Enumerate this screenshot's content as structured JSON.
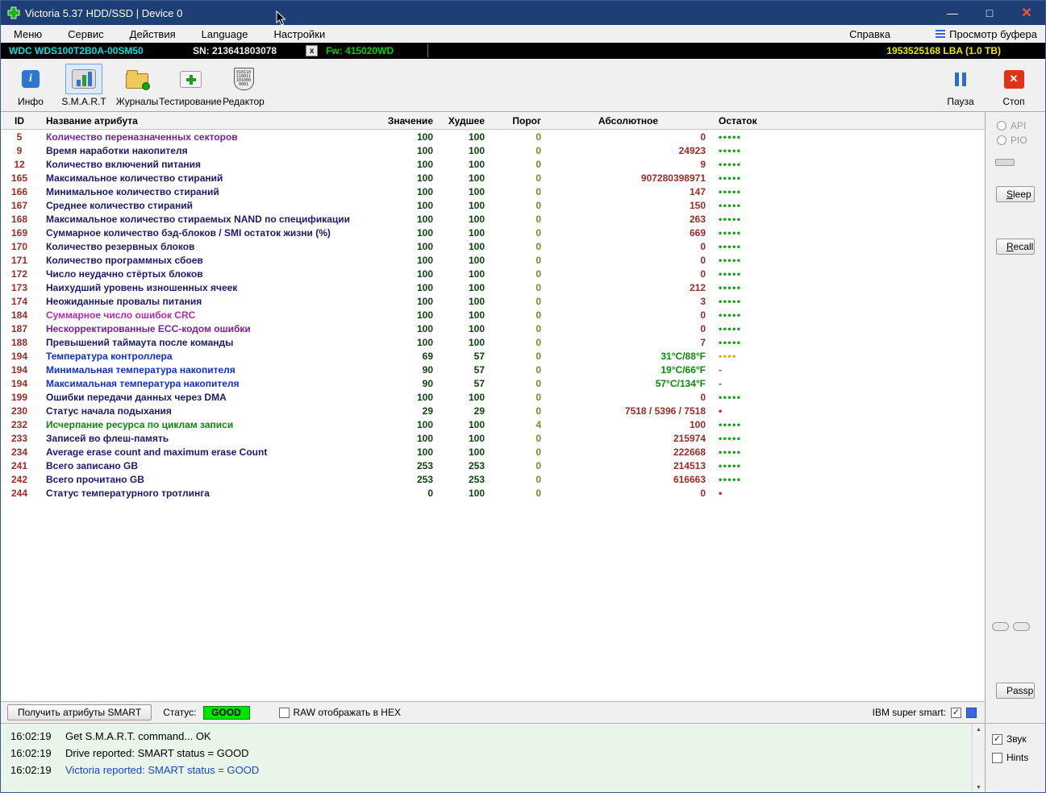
{
  "window": {
    "title": "Victoria 5.37 HDD/SSD | Device 0",
    "minimize": "—",
    "maximize": "□",
    "close": "✕"
  },
  "menu": {
    "items": [
      "Меню",
      "Сервис",
      "Действия",
      "Language",
      "Настройки"
    ],
    "help": "Справка",
    "buffer_view": "Просмотр буфера"
  },
  "device_bar": {
    "model": "WDC  WDS100T2B0A-00SM50",
    "serial": "SN: 213641803078",
    "x_badge": "x",
    "firmware": "Fw: 415020WD",
    "capacity": "1953525168 LBA (1.0 TB)"
  },
  "toolbar": {
    "info": "Инфо",
    "smart": "S.M.A.R.T",
    "journals": "Журналы",
    "testing": "Тестирование",
    "editor": "Редактор",
    "pause": "Пауза",
    "stop": "Стоп",
    "editor_binary": [
      "010110",
      "110011",
      "101000",
      "0001"
    ]
  },
  "table": {
    "headers": [
      "ID",
      "Название атрибута",
      "Значение",
      "Худшее",
      "Порог",
      "Абсолютное",
      "Остаток"
    ],
    "rows": [
      {
        "id": "5",
        "name": "Количество переназначенных секторов",
        "name_color": "purple",
        "value": "100",
        "worst": "100",
        "threshold": "0",
        "raw": "0",
        "raw_color": "maroon",
        "health": "•••••",
        "health_color": "green"
      },
      {
        "id": "9",
        "name": "Время наработки накопителя",
        "name_color": "navy",
        "value": "100",
        "worst": "100",
        "threshold": "0",
        "raw": "24923",
        "raw_color": "maroon",
        "health": "•••••",
        "health_color": "green"
      },
      {
        "id": "12",
        "name": "Количество включений питания",
        "name_color": "navy",
        "value": "100",
        "worst": "100",
        "threshold": "0",
        "raw": "9",
        "raw_color": "maroon",
        "health": "•••••",
        "health_color": "green"
      },
      {
        "id": "165",
        "name": "Максимальное количество стираний",
        "name_color": "navy",
        "value": "100",
        "worst": "100",
        "threshold": "0",
        "raw": "907280398971",
        "raw_color": "maroon",
        "health": "•••••",
        "health_color": "green"
      },
      {
        "id": "166",
        "name": "Минимальное количество стираний",
        "name_color": "navy",
        "value": "100",
        "worst": "100",
        "threshold": "0",
        "raw": "147",
        "raw_color": "maroon",
        "health": "•••••",
        "health_color": "green"
      },
      {
        "id": "167",
        "name": "Среднее количество стираний",
        "name_color": "navy",
        "value": "100",
        "worst": "100",
        "threshold": "0",
        "raw": "150",
        "raw_color": "maroon",
        "health": "•••••",
        "health_color": "green"
      },
      {
        "id": "168",
        "name": "Максимальное количество стираемых NAND по спецификации",
        "name_color": "navy",
        "value": "100",
        "worst": "100",
        "threshold": "0",
        "raw": "263",
        "raw_color": "maroon",
        "health": "•••••",
        "health_color": "green"
      },
      {
        "id": "169",
        "name": "Суммарное количество бэд-блоков / SMI остаток жизни (%)",
        "name_color": "navy",
        "value": "100",
        "worst": "100",
        "threshold": "0",
        "raw": "669",
        "raw_color": "maroon",
        "health": "•••••",
        "health_color": "green"
      },
      {
        "id": "170",
        "name": "Количество резервных блоков",
        "name_color": "navy",
        "value": "100",
        "worst": "100",
        "threshold": "0",
        "raw": "0",
        "raw_color": "maroon",
        "health": "•••••",
        "health_color": "green"
      },
      {
        "id": "171",
        "name": "Количество программных сбоев",
        "name_color": "navy",
        "value": "100",
        "worst": "100",
        "threshold": "0",
        "raw": "0",
        "raw_color": "maroon",
        "health": "•••••",
        "health_color": "green"
      },
      {
        "id": "172",
        "name": "Число неудачно стёртых блоков",
        "name_color": "navy",
        "value": "100",
        "worst": "100",
        "threshold": "0",
        "raw": "0",
        "raw_color": "maroon",
        "health": "•••••",
        "health_color": "green"
      },
      {
        "id": "173",
        "name": "Наихудший уровень изношенных ячеек",
        "name_color": "navy",
        "value": "100",
        "worst": "100",
        "threshold": "0",
        "raw": "212",
        "raw_color": "maroon",
        "health": "•••••",
        "health_color": "green"
      },
      {
        "id": "174",
        "name": "Неожиданные провалы питания",
        "name_color": "navy",
        "value": "100",
        "worst": "100",
        "threshold": "0",
        "raw": "3",
        "raw_color": "maroon",
        "health": "•••••",
        "health_color": "green"
      },
      {
        "id": "184",
        "name": "Суммарное число ошибок CRC",
        "name_color": "magenta",
        "value": "100",
        "worst": "100",
        "threshold": "0",
        "raw": "0",
        "raw_color": "maroon",
        "health": "•••••",
        "health_color": "green"
      },
      {
        "id": "187",
        "name": "Нескорректированные ECC-кодом ошибки",
        "name_color": "purple",
        "value": "100",
        "worst": "100",
        "threshold": "0",
        "raw": "0",
        "raw_color": "maroon",
        "health": "•••••",
        "health_color": "green"
      },
      {
        "id": "188",
        "name": "Превышений таймаута после команды",
        "name_color": "navy",
        "value": "100",
        "worst": "100",
        "threshold": "0",
        "raw": "7",
        "raw_color": "maroon",
        "health": "•••••",
        "health_color": "green"
      },
      {
        "id": "194",
        "name": "Температура контроллера",
        "name_color": "blue",
        "value": "69",
        "worst": "57",
        "threshold": "0",
        "raw": "31°C/88°F",
        "raw_color": "green",
        "health": "••••",
        "health_color": "orange"
      },
      {
        "id": "194",
        "name": "Минимальная температура накопителя",
        "name_color": "blue",
        "value": "90",
        "worst": "57",
        "threshold": "0",
        "raw": "19°C/66°F",
        "raw_color": "green",
        "health": "-",
        "health_color": "gray"
      },
      {
        "id": "194",
        "name": "Максимальная температура накопителя",
        "name_color": "blue",
        "value": "90",
        "worst": "57",
        "threshold": "0",
        "raw": "57°C/134°F",
        "raw_color": "green",
        "health": "-",
        "health_color": "gray"
      },
      {
        "id": "199",
        "name": "Ошибки передачи данных через DMA",
        "name_color": "navy",
        "value": "100",
        "worst": "100",
        "threshold": "0",
        "raw": "0",
        "raw_color": "maroon",
        "health": "•••••",
        "health_color": "green"
      },
      {
        "id": "230",
        "name": "Статус начала подыхания",
        "name_color": "navy",
        "value": "29",
        "worst": "29",
        "threshold": "0",
        "raw": "7518 / 5396 / 7518",
        "raw_color": "maroon",
        "health": "•",
        "health_color": "red"
      },
      {
        "id": "232",
        "name": "Исчерпание ресурса по циклам записи",
        "name_color": "green",
        "value": "100",
        "worst": "100",
        "threshold": "4",
        "raw": "100",
        "raw_color": "maroon",
        "health": "•••••",
        "health_color": "green"
      },
      {
        "id": "233",
        "name": "Записей во флеш-память",
        "name_color": "navy",
        "value": "100",
        "worst": "100",
        "threshold": "0",
        "raw": "215974",
        "raw_color": "maroon",
        "health": "•••••",
        "health_color": "green"
      },
      {
        "id": "234",
        "name": "Average erase count and maximum erase Count",
        "name_color": "navy",
        "value": "100",
        "worst": "100",
        "threshold": "0",
        "raw": "222668",
        "raw_color": "maroon",
        "health": "•••••",
        "health_color": "green"
      },
      {
        "id": "241",
        "name": "Всего записано GB",
        "name_color": "navy",
        "value": "253",
        "worst": "253",
        "threshold": "0",
        "raw": "214513",
        "raw_color": "maroon",
        "health": "•••••",
        "health_color": "green"
      },
      {
        "id": "242",
        "name": "Всего прочитано GB",
        "name_color": "navy",
        "value": "253",
        "worst": "253",
        "threshold": "0",
        "raw": "616663",
        "raw_color": "maroon",
        "health": "•••••",
        "health_color": "green"
      },
      {
        "id": "244",
        "name": "Статус температурного тротлинга",
        "name_color": "navy",
        "value": "0",
        "worst": "100",
        "threshold": "0",
        "raw": "0",
        "raw_color": "maroon",
        "health": "•",
        "health_color": "red"
      }
    ]
  },
  "side_panel": {
    "api": "API",
    "pio": "PIO",
    "sleep": "Sleep",
    "recall": "Recall",
    "passp": "Passp",
    "sound": "Звук",
    "hints": "Hints"
  },
  "status_bar": {
    "get_smart": "Получить атрибуты SMART",
    "status_label": "Статус:",
    "status_value": "GOOD",
    "raw_hex": "RAW отображать в HEX",
    "ibm": "IBM super smart:",
    "check_glyph": "✓"
  },
  "log": {
    "lines": [
      {
        "time": "16:02:19",
        "text": "Get S.M.A.R.T. command... OK",
        "color": "black"
      },
      {
        "time": "16:02:19",
        "text": "Drive reported: SMART status = GOOD",
        "color": "black"
      },
      {
        "time": "16:02:19",
        "text": "Victoria reported: SMART status = GOOD",
        "color": "blue"
      }
    ]
  }
}
